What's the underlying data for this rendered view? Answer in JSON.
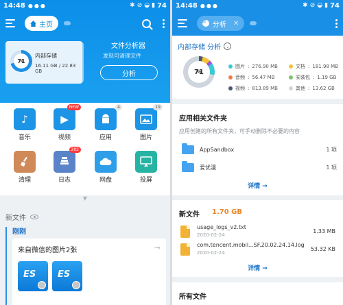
{
  "status_left": {
    "time": "14:48",
    "battery": "74"
  },
  "status_right": {
    "time": "14:48",
    "battery": "74"
  },
  "left": {
    "tab_label": "主页",
    "storage": {
      "percent": "71",
      "percent_sign": "%",
      "label": "内部存储",
      "size": "16.11 GB / 22.83 GB"
    },
    "analyzer": {
      "title": "文件分析器",
      "subtitle": "发现可清理文件",
      "button": "分析"
    },
    "grid": [
      {
        "label": "音乐",
        "icon": "music-icon",
        "color": "#1c95e6",
        "badge": ""
      },
      {
        "label": "视频",
        "icon": "video-icon",
        "color": "#1c95e6",
        "badge": "NEW"
      },
      {
        "label": "应用",
        "icon": "android-icon",
        "color": "#1c95e6",
        "badge": "4"
      },
      {
        "label": "图片",
        "icon": "image-icon",
        "color": "#1c95e6",
        "badge": "19"
      },
      {
        "label": "清理",
        "icon": "broom-icon",
        "color": "#d08958",
        "badge": ""
      },
      {
        "label": "日志",
        "icon": "log-icon",
        "color": "#5b83c9",
        "badge": "202"
      },
      {
        "label": "网盘",
        "icon": "cloud-icon",
        "color": "#2f9ee8",
        "badge": ""
      },
      {
        "label": "投屏",
        "icon": "cast-icon",
        "color": "#27b3a3",
        "badge": ""
      }
    ],
    "recent": {
      "title": "新文件",
      "group": "刚刚",
      "card_title": "来自微信的图片2张",
      "arrow": "→"
    }
  },
  "right": {
    "tab_label": "分析",
    "close": "✕",
    "storage_title": "内部存储 分析",
    "percent": "71",
    "percent_sign": "%",
    "legend": [
      {
        "label": "图片",
        "value": "276.90 MB",
        "color": "#3cc8d4"
      },
      {
        "label": "文档",
        "value": "181.98 MB",
        "color": "#f6c23a"
      },
      {
        "label": "音频",
        "value": "56.47 MB",
        "color": "#f07b4b"
      },
      {
        "label": "安装包",
        "value": "1.19 GB",
        "color": "#7ec46a"
      },
      {
        "label": "视频",
        "value": "813.89 MB",
        "color": "#4a5872"
      },
      {
        "label": "其他",
        "value": "13.62 GB",
        "color": "#cfd5dc"
      }
    ],
    "app_folders": {
      "title": "应用相关文件夹",
      "subtitle": "应用创建的所有文件夹，可手动删除不必要的内容",
      "items": [
        {
          "name": "AppSandbox",
          "count": "1 项"
        },
        {
          "name": "爱优漫",
          "count": "1 项"
        }
      ],
      "detail": "详情 →"
    },
    "new_files": {
      "title": "新文件",
      "size": "1.70 GB",
      "items": [
        {
          "name": "usage_logs_v2.txt",
          "date": "2020-02-24",
          "size": "1.33 MB"
        },
        {
          "name": "com.tencent.mobil...SF.20.02.24.14.log",
          "date": "2020-02-24",
          "size": "53.32 KB"
        }
      ],
      "detail": "详情 →"
    },
    "all_files": {
      "title": "所有文件"
    }
  }
}
